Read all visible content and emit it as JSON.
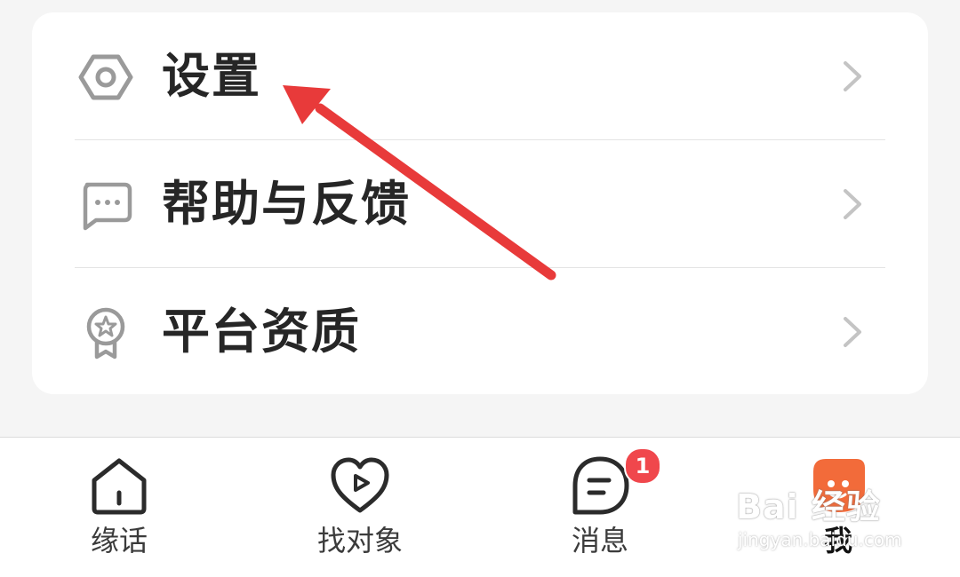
{
  "menu": {
    "items": [
      {
        "label": "设置",
        "icon": "gear-hexagon-icon"
      },
      {
        "label": "帮助与反馈",
        "icon": "chat-bubble-icon"
      },
      {
        "label": "平台资质",
        "icon": "award-badge-icon"
      }
    ]
  },
  "tabbar": {
    "tabs": [
      {
        "label": "缘话",
        "icon": "home-icon",
        "active": false
      },
      {
        "label": "找对象",
        "icon": "heart-play-icon",
        "active": false
      },
      {
        "label": "消息",
        "icon": "message-icon",
        "active": false,
        "badge": "1"
      },
      {
        "label": "我",
        "icon": "profile-mascot-icon",
        "active": true
      }
    ]
  },
  "watermark": {
    "main": "Bai 经验",
    "sub": "jingyan.baidu.com"
  },
  "colors": {
    "background": "#f5f5f5",
    "card": "#ffffff",
    "text_primary": "#262626",
    "icon_gray": "#9a9a9a",
    "arrow_red": "#e83a3a",
    "badge_red": "#f0474c",
    "active_tab_orange": "#f26b3a"
  }
}
